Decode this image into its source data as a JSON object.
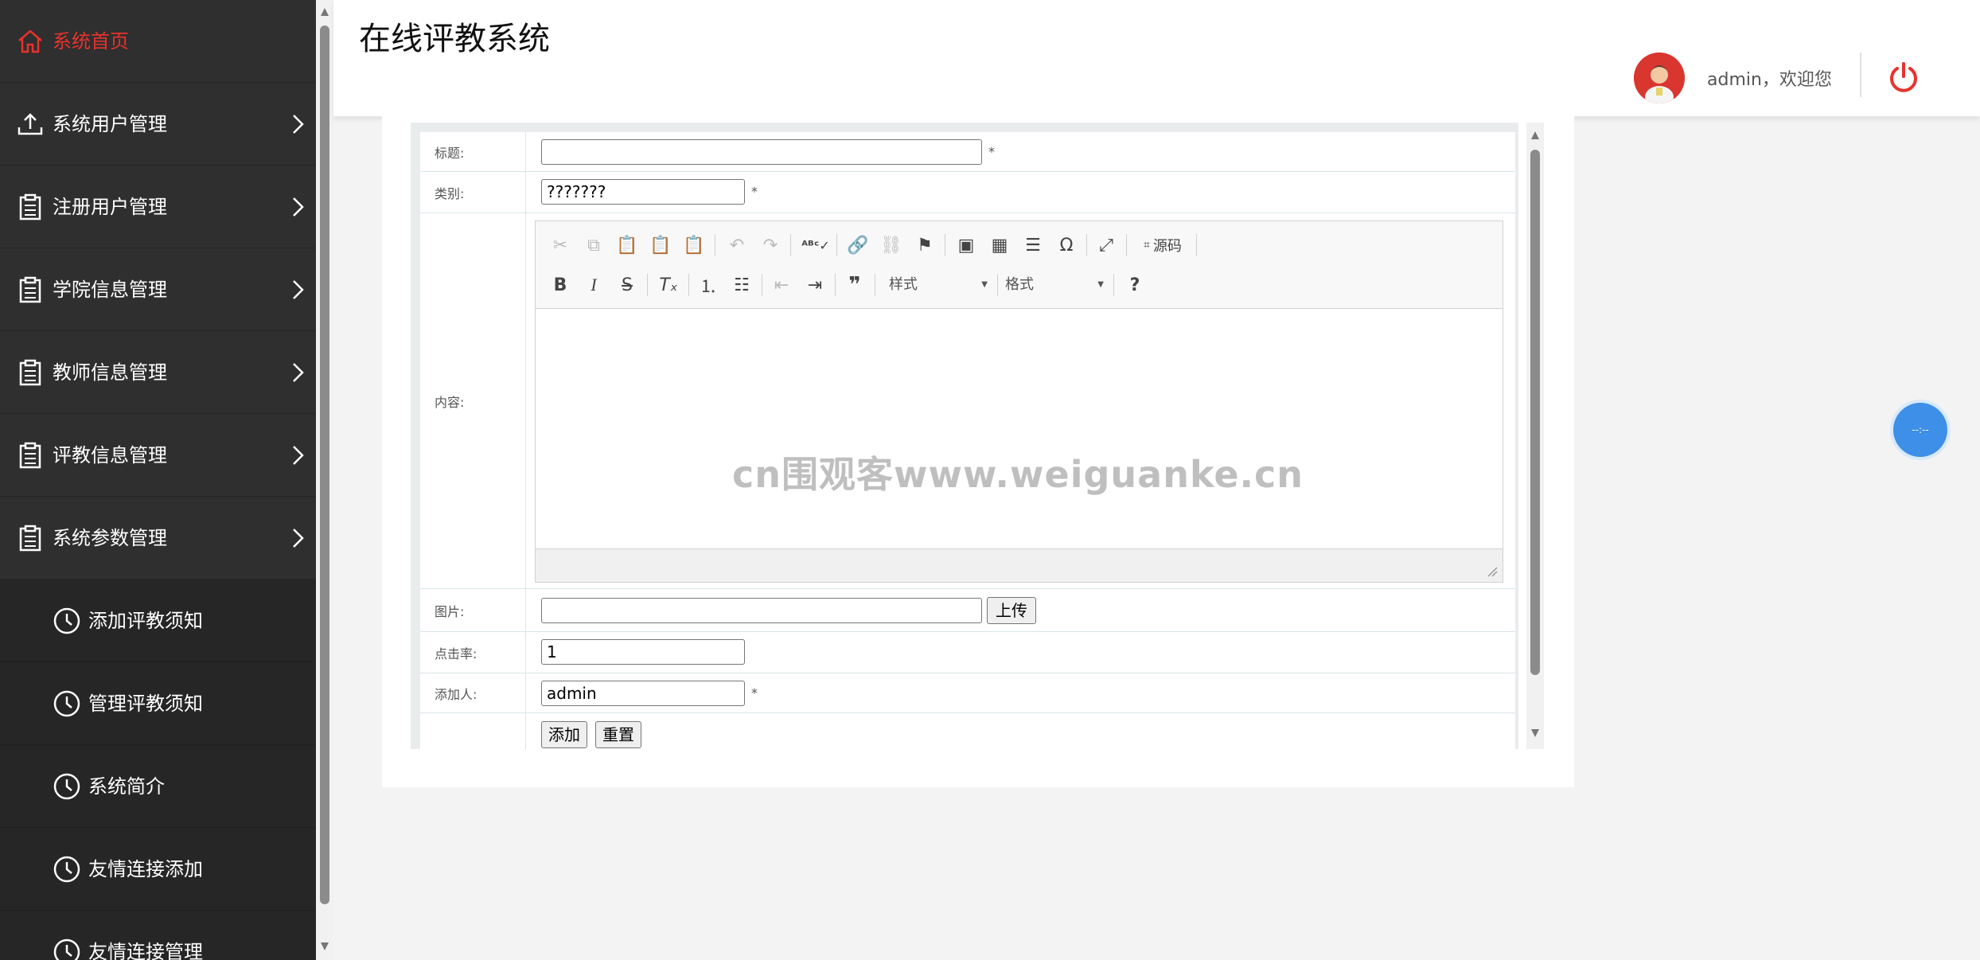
{
  "sidebar": {
    "items": [
      {
        "label": "系统首页",
        "icon": "home-icon"
      },
      {
        "label": "系统用户管理",
        "icon": "upload-icon"
      },
      {
        "label": "注册用户管理",
        "icon": "clipboard-icon"
      },
      {
        "label": "学院信息管理",
        "icon": "clipboard-icon"
      },
      {
        "label": "教师信息管理",
        "icon": "clipboard-icon"
      },
      {
        "label": "评教信息管理",
        "icon": "clipboard-icon"
      },
      {
        "label": "系统参数管理",
        "icon": "clipboard-icon"
      }
    ],
    "subitems": [
      {
        "label": "添加评教须知",
        "icon": "clock-icon"
      },
      {
        "label": "管理评教须知",
        "icon": "clock-icon"
      },
      {
        "label": "系统简介",
        "icon": "clock-icon"
      },
      {
        "label": "友情连接添加",
        "icon": "clock-icon"
      },
      {
        "label": "友情连接管理",
        "icon": "clock-icon"
      }
    ]
  },
  "header": {
    "title": "在线评教系统",
    "welcome": "admin，欢迎您"
  },
  "form": {
    "title_label": "标题:",
    "title_value": "",
    "title_required": "*",
    "category_label": "类别:",
    "category_value": "???????",
    "category_required": "*",
    "content_label": "内容:",
    "image_label": "图片:",
    "image_value": "",
    "upload_button": "上传",
    "clicks_label": "点击率:",
    "clicks_value": "1",
    "adder_label": "添加人:",
    "adder_value": "admin",
    "adder_required": "*",
    "add_button": "添加",
    "reset_button": "重置"
  },
  "editor": {
    "source_label": "源码",
    "style_combo": "样式",
    "format_combo": "格式"
  },
  "watermark": "cn围观客www.weiguanke.cn",
  "float_widget": "--:--",
  "colors": {
    "sidebar_bg": "#2f2f2f",
    "active_red": "#e8322c",
    "widget_blue": "#3d8fe8"
  }
}
